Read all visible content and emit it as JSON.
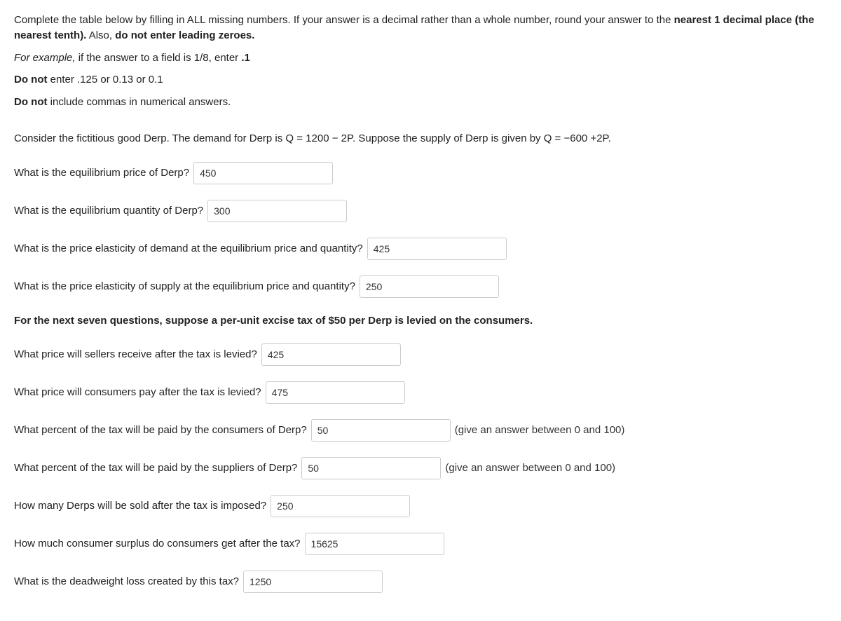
{
  "instructions": {
    "line1a": "Complete the table below by filling in ALL missing numbers. If your answer is a decimal rather than a whole number, round your answer to the ",
    "line1b": "nearest 1 decimal place (the nearest tenth).",
    "line1c": " Also, ",
    "line1d": "do not enter leading zeroes.",
    "example_lead": "For example,",
    "example_rest": " if the answer to a field is 1/8, enter ",
    "example_val": ".1",
    "donot1a": "Do not",
    "donot1b": " enter .125  or  0.13  or  0.1",
    "donot2a": "Do not",
    "donot2b": " include commas in numerical answers."
  },
  "problem_intro": "Consider the fictitious good Derp. The demand for Derp is Q = 1200 − 2P. Suppose the supply of Derp is given by Q = −600 +2P.",
  "questions": {
    "q1": {
      "label": "What is the equilibrium price of Derp?",
      "value": "450"
    },
    "q2": {
      "label": "What is the equilibrium quantity of Derp?",
      "value": "300"
    },
    "q3": {
      "label": "What is the price elasticity of demand at the equilibrium price and quantity?",
      "value": "425"
    },
    "q4": {
      "label": "What is the price elasticity of supply at the equilibrium price and quantity?",
      "value": "250"
    },
    "section": "For the next seven questions, suppose a per-unit excise tax of $50 per Derp is levied on the consumers.",
    "q5": {
      "label": "What price will sellers receive after the tax is levied?",
      "value": "425"
    },
    "q6": {
      "label": "What price will consumers pay after the tax is levied?",
      "value": "475"
    },
    "q7": {
      "label": "What percent of the tax will be paid by the consumers of Derp?",
      "value": "50",
      "suffix": "(give an answer between 0 and 100)"
    },
    "q8": {
      "label": "What percent of the tax will be paid by the suppliers of Derp?",
      "value": "50",
      "suffix": "(give an answer between 0 and 100)"
    },
    "q9": {
      "label": "How many Derps will be sold after the tax is imposed?",
      "value": "250"
    },
    "q10": {
      "label": "How much consumer surplus do consumers get after the tax?",
      "value": "15625"
    },
    "q11": {
      "label": "What is the deadweight loss created by this tax?",
      "value": "1250"
    }
  }
}
